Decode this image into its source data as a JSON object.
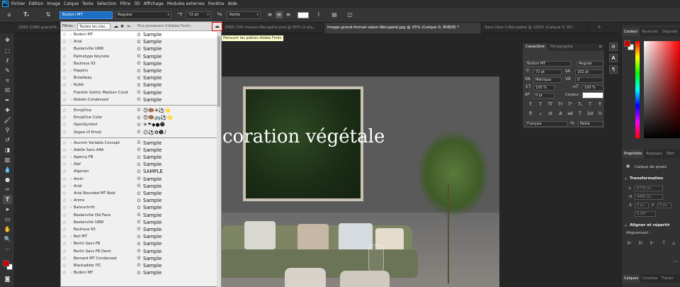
{
  "menubar": {
    "logo": "Ps",
    "items": [
      "Fichier",
      "Edition",
      "Image",
      "Calque",
      "Texte",
      "Sélection",
      "Filtre",
      "3D",
      "Affichage",
      "Modules externes",
      "Fenêtre",
      "Aide"
    ]
  },
  "options": {
    "font_family": "Bodoni MT",
    "font_style": "Regular",
    "font_size": "72 pt",
    "antialias": "Nette",
    "text_color": "#ffffff"
  },
  "tabs": [
    {
      "label": "2560-1080-grand-R..."
    },
    {
      "label": "2560-700-moyen-Récupéré.psd @ 50% (Calq..."
    },
    {
      "label": "Image-grand-format-salon-Récupéré.jpg @ 25% (Calque 0, RVB/8) *"
    },
    {
      "label": "Sans titre-1-Récupéré @ 100% (Calque 3, RV..."
    }
  ],
  "canvas": {
    "headline": "coration végétale",
    "tooltip": "Parcourir les polices Adobe Fonts"
  },
  "font_menu": {
    "filter_label": "Filtres :",
    "filter_value": "Toutes les clas...",
    "adobe_label": "Plus provenant d'Adobe Fonts :",
    "groups": [
      [
        {
          "name": "Bodoni MT",
          "arrow": "›",
          "type": "O",
          "sample": "Sample"
        },
        {
          "name": "Arial",
          "arrow": "›",
          "type": "O",
          "sample": "Sample"
        },
        {
          "name": "Baskerville URW",
          "arrow": "",
          "type": "O",
          "sample": "Sample"
        },
        {
          "name": "Palmotype Keynote",
          "arrow": "",
          "type": "O",
          "sample": "Sample"
        },
        {
          "name": "Bauhaus 93",
          "arrow": "",
          "type": "O",
          "sample": "Sample"
        },
        {
          "name": "Poppins",
          "arrow": "›",
          "type": "O",
          "sample": "Sample"
        },
        {
          "name": "Broadway",
          "arrow": "",
          "type": "O",
          "sample": "Sample"
        },
        {
          "name": "Rubik",
          "arrow": "›",
          "type": "O",
          "sample": "Sample"
        },
        {
          "name": "Franklin Gothic Medium Cond",
          "arrow": "",
          "type": "O",
          "sample": "Sample"
        },
        {
          "name": "Roboto Condensed",
          "arrow": "›",
          "type": "O",
          "sample": "Sample"
        }
      ],
      [
        {
          "name": "EmojiOne",
          "arrow": "",
          "type": "O",
          "sample": "😊🍩✈⚽🌟"
        },
        {
          "name": "EmojiOne Color",
          "arrow": "",
          "type": "O",
          "sample": "😊🍩🚌⚽🌟"
        },
        {
          "name": "OpenSymbol",
          "arrow": "",
          "type": "O",
          "sample": "✈☂◆●☻"
        },
        {
          "name": "Segoe UI Emoji",
          "arrow": "",
          "type": "O",
          "sample": "☺⚽✿☻♪"
        }
      ],
      [
        {
          "name": "Acumin Variable Concept",
          "arrow": "›",
          "type": "O",
          "sample": "Sample"
        },
        {
          "name": "Adelle Sans ARA",
          "arrow": "›",
          "type": "O",
          "sample": "Sample"
        },
        {
          "name": "Agency FB",
          "arrow": "›",
          "type": "O",
          "sample": "Sample"
        },
        {
          "name": "Alef",
          "arrow": "›",
          "type": "O",
          "sample": "Sample"
        },
        {
          "name": "Algerian",
          "arrow": "",
          "type": "O",
          "sample": "SAMPLE"
        },
        {
          "name": "Amiri",
          "arrow": "›",
          "type": "O",
          "sample": "Sample"
        },
        {
          "name": "Arial",
          "arrow": "›",
          "type": "O",
          "sample": "Sample"
        },
        {
          "name": "Arial Rounded MT Bold",
          "arrow": "",
          "type": "O",
          "sample": "Sample"
        },
        {
          "name": "Arimo",
          "arrow": "›",
          "type": "O",
          "sample": "Sample"
        },
        {
          "name": "Bahnschrift",
          "arrow": "›",
          "type": "O",
          "sample": "Sample"
        },
        {
          "name": "Baskerville Old Face",
          "arrow": "",
          "type": "O",
          "sample": "Sample"
        },
        {
          "name": "Baskerville URW",
          "arrow": "",
          "type": "O",
          "sample": "Sample"
        },
        {
          "name": "Bauhaus 93",
          "arrow": "",
          "type": "O",
          "sample": "Sample"
        },
        {
          "name": "Bell MT",
          "arrow": "›",
          "type": "O",
          "sample": "Sample"
        },
        {
          "name": "Berlin Sans FB",
          "arrow": "›",
          "type": "O",
          "sample": "Sample"
        },
        {
          "name": "Berlin Sans FB Demi",
          "arrow": "",
          "type": "O",
          "sample": "Sample"
        },
        {
          "name": "Bernard MT Condensed",
          "arrow": "",
          "type": "O",
          "sample": "Sample"
        },
        {
          "name": "Blackadder ITC",
          "arrow": "",
          "type": "O",
          "sample": "Sample"
        },
        {
          "name": "Bodoni MT",
          "arrow": "›",
          "type": "O",
          "sample": "Sample"
        }
      ]
    ]
  },
  "char_panel": {
    "tabs": [
      "Caractère",
      "Paragraphe"
    ],
    "font": "Bodoni MT",
    "style": "Regular",
    "size": "72 pt",
    "leading": "162 pt",
    "kerning": "Métrique",
    "tracking": "0",
    "vscale": "100 %",
    "hscale": "100 %",
    "baseline": "0 pt",
    "color_label": "Couleur :",
    "language": "Français",
    "aa": "Nette",
    "style_buttons": [
      "T",
      "T",
      "TT",
      "Tт",
      "T¹",
      "T₁",
      "T",
      "Ŧ"
    ],
    "ot_buttons": [
      "fi",
      "ℴ",
      "st",
      "Ꭿ",
      "ad",
      "T",
      "1st",
      "½"
    ]
  },
  "dock": {
    "color_tabs": [
      "Couleur",
      "Nuancier",
      "Dégradé"
    ],
    "props_tabs": [
      "Propriétés",
      "Réglages",
      "Bibli"
    ],
    "layer_type": "Calque de pixels",
    "transform": "Transformation",
    "w_label": "L",
    "h_label": "H",
    "x_label": "X",
    "y_label": "Y",
    "w_val": "6720 px",
    "h_val": "4480 px",
    "x_val": "0 px",
    "y_val": "0 px",
    "angle_val": "0,00°",
    "align_title": "Aligner et répartir",
    "align_label": "Alignement :",
    "bottom_tabs": [
      "Calques",
      "Couches",
      "Tracés"
    ]
  },
  "colors": {
    "foreground": "#d40000",
    "background": "#ffffff",
    "highlight": "#d00000"
  }
}
